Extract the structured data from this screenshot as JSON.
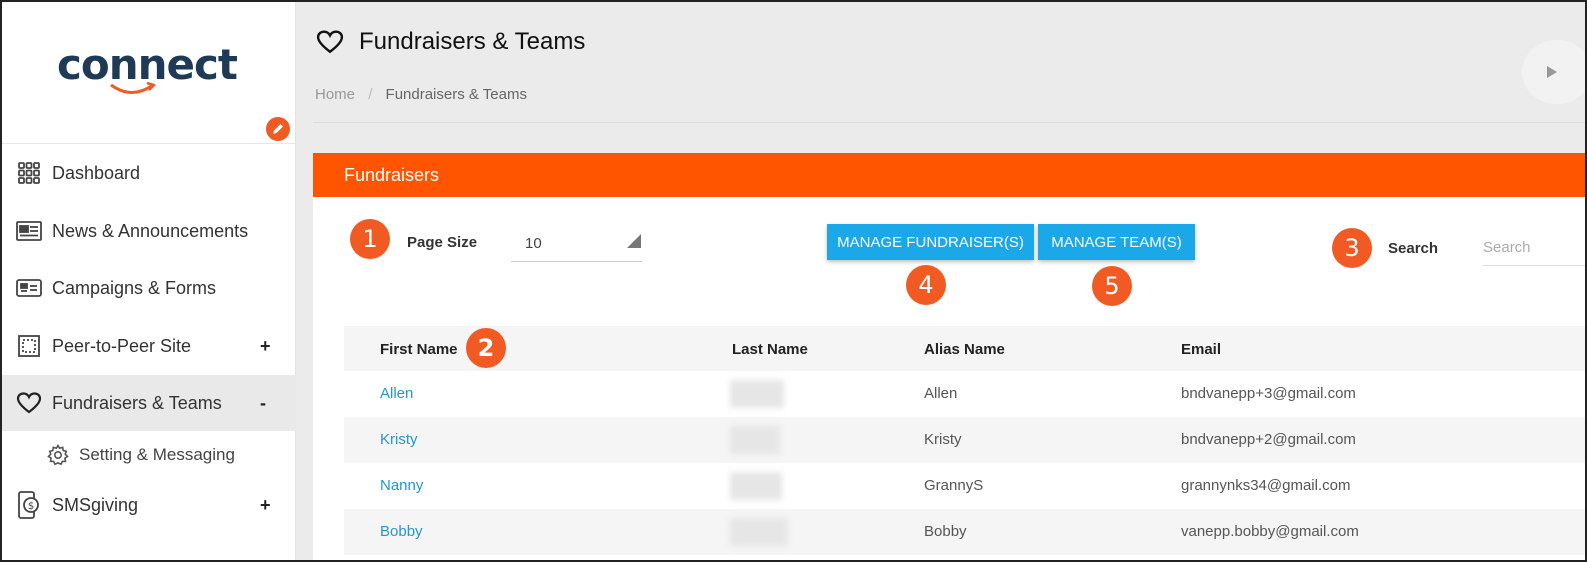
{
  "brand": {
    "name": "connect",
    "accent": "#f15a22",
    "logo_color": "#1f3a57"
  },
  "sidebar": {
    "items": [
      {
        "label": "Dashboard",
        "icon": "grid-icon",
        "toggle": ""
      },
      {
        "label": "News & Announcements",
        "icon": "newspaper-icon",
        "toggle": ""
      },
      {
        "label": "Campaigns & Forms",
        "icon": "id-card-icon",
        "toggle": ""
      },
      {
        "label": "Peer-to-Peer Site",
        "icon": "frame-icon",
        "toggle": "+"
      },
      {
        "label": "Fundraisers & Teams",
        "icon": "heart-icon",
        "toggle": "-",
        "active": true
      },
      {
        "label": "Setting & Messaging",
        "icon": "gear-icon",
        "sub": true
      },
      {
        "label": "SMSgiving",
        "icon": "phone-dollar-icon",
        "toggle": "+"
      }
    ]
  },
  "header": {
    "title": "Fundraisers & Teams",
    "title_icon": "heart-icon",
    "breadcrumb": {
      "home": "Home",
      "separator": "/",
      "current": "Fundraisers & Teams"
    }
  },
  "panel": {
    "title": "Fundraisers",
    "header_color": "#ff5500",
    "page_size_label": "Page Size",
    "page_size_value": "10",
    "manage_fundraisers_label": "MANAGE FUNDRAISER(S)",
    "manage_teams_label": "MANAGE TEAM(S)",
    "search_label": "Search",
    "search_placeholder": "Search",
    "button_color": "#1aa8e8"
  },
  "callouts": [
    "1",
    "2",
    "3",
    "4",
    "5"
  ],
  "table": {
    "columns": [
      "First Name",
      "Last Name",
      "Alias Name",
      "Email"
    ],
    "rows": [
      {
        "first_name": "Allen",
        "alias": "Allen",
        "email": "bndvanepp+3@gmail.com"
      },
      {
        "first_name": "Kristy",
        "alias": "Kristy",
        "email": "bndvanepp+2@gmail.com"
      },
      {
        "first_name": "Nanny",
        "alias": "GrannyS",
        "email": "grannynks34@gmail.com"
      },
      {
        "first_name": "Bobby",
        "alias": "Bobby",
        "email": "vanepp.bobby@gmail.com"
      }
    ]
  }
}
